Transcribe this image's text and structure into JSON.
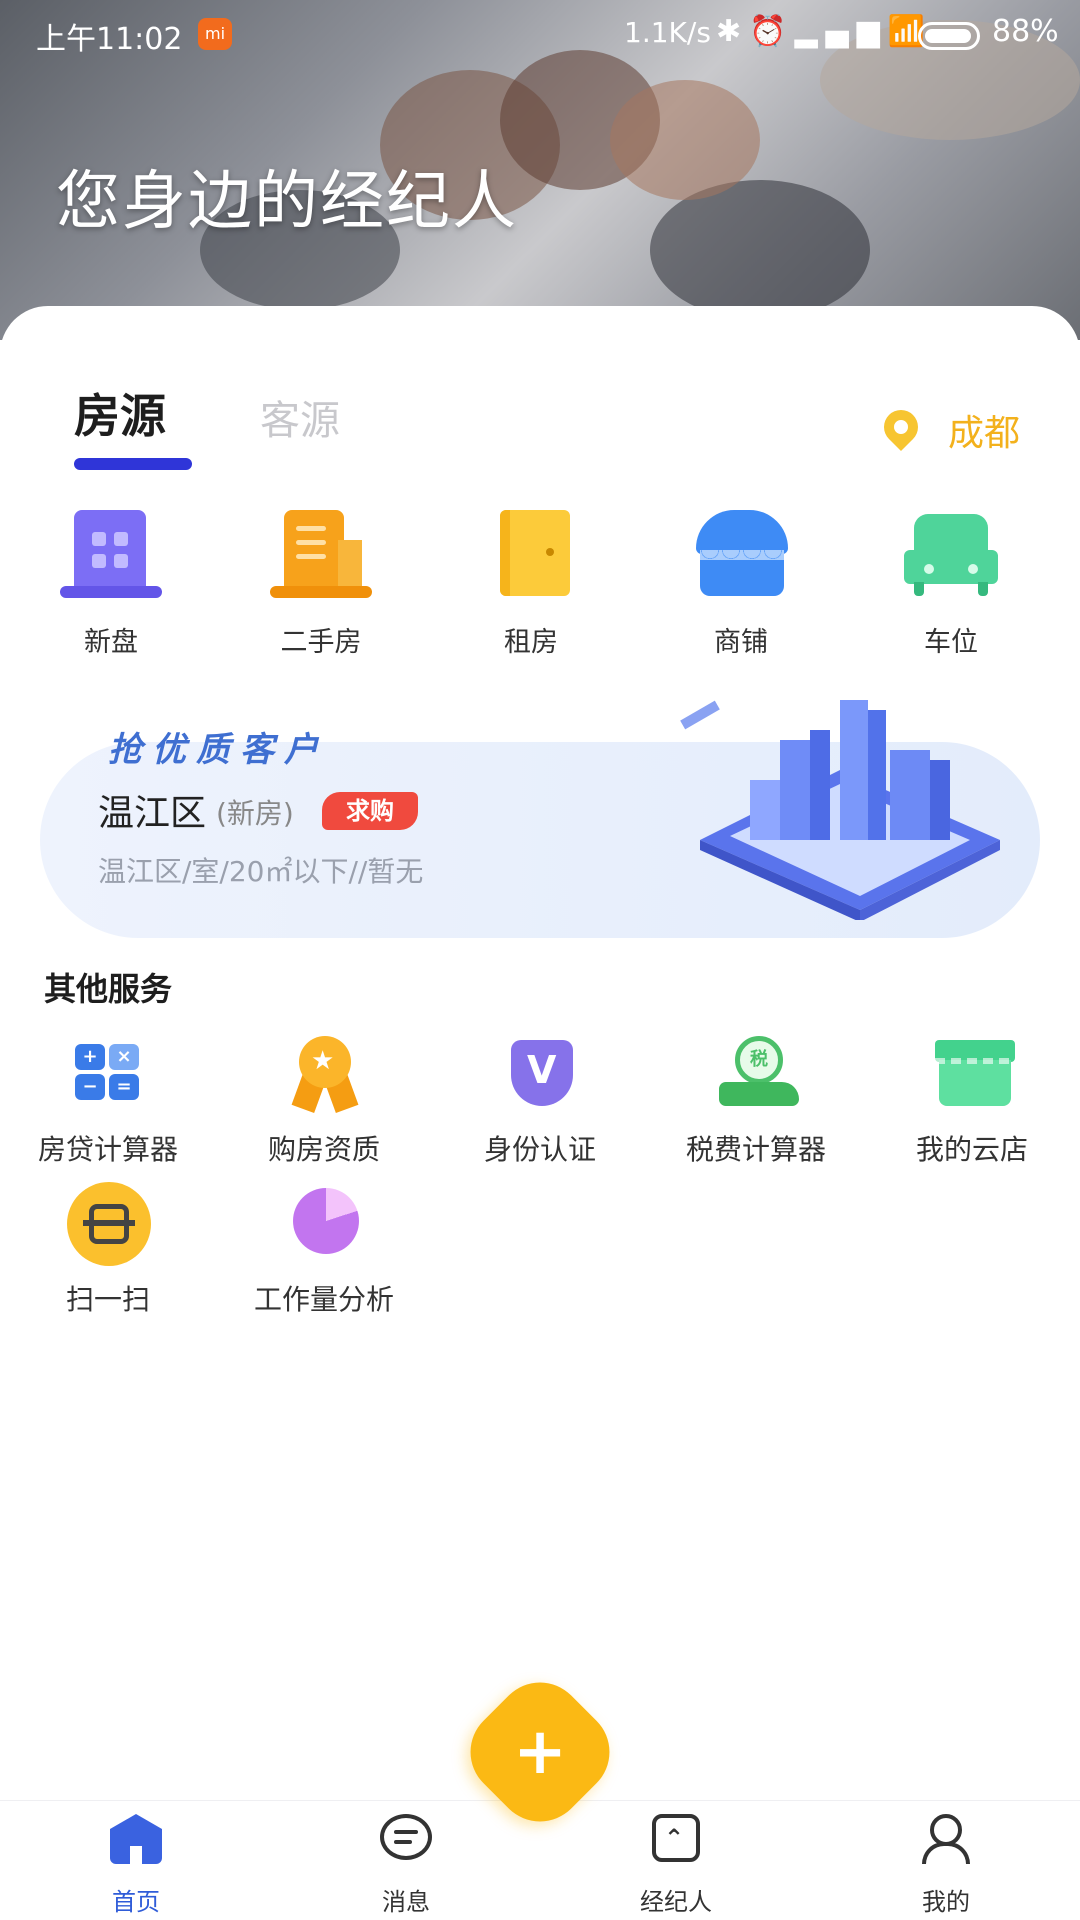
{
  "status_bar": {
    "time": "上午11:02",
    "net_speed": "1.1K/s",
    "battery": "88%",
    "icons": [
      "bluetooth-icon",
      "alarm-icon",
      "signal-icon",
      "wifi-icon",
      "battery-icon"
    ]
  },
  "hero": {
    "title": "您身边的经纪人"
  },
  "tabs": {
    "active": "房源",
    "inactive": "客源"
  },
  "location": {
    "city": "成都",
    "icon": "location-pin-icon"
  },
  "categories": [
    {
      "label": "新盘",
      "icon": "building-icon",
      "color": "#7c6ef5"
    },
    {
      "label": "二手房",
      "icon": "office-building-icon",
      "color": "#f7a21b"
    },
    {
      "label": "租房",
      "icon": "door-icon",
      "color": "#fccb3a"
    },
    {
      "label": "商铺",
      "icon": "shop-icon",
      "color": "#3e8bf5"
    },
    {
      "label": "车位",
      "icon": "car-icon",
      "color": "#4fd49a"
    }
  ],
  "banner": {
    "tag": "抢优质客户",
    "district": "温江区",
    "type": "(新房)",
    "badge": "求购",
    "desc": "温江区/室/20㎡以下//暂无"
  },
  "services": {
    "title": "其他服务",
    "items": [
      {
        "label": "房贷计算器",
        "icon": "calculator-icon"
      },
      {
        "label": "购房资质",
        "icon": "medal-icon"
      },
      {
        "label": "身份认证",
        "icon": "shield-v-icon"
      },
      {
        "label": "税费计算器",
        "icon": "tax-coin-hand-icon"
      },
      {
        "label": "我的云店",
        "icon": "store-icon"
      },
      {
        "label": "扫一扫",
        "icon": "scan-icon"
      },
      {
        "label": "工作量分析",
        "icon": "pie-chart-icon"
      }
    ]
  },
  "bottom_nav": {
    "items": [
      {
        "label": "首页",
        "icon": "home-icon",
        "active": true
      },
      {
        "label": "消息",
        "icon": "message-icon",
        "active": false
      },
      {
        "label": "经纪人",
        "icon": "agent-icon",
        "active": false
      },
      {
        "label": "我的",
        "icon": "profile-icon",
        "active": false
      }
    ],
    "fab": "+"
  },
  "colors": {
    "accent": "#2f35d8",
    "brand_yellow": "#fbb914",
    "city": "#f3b11c",
    "badge_red": "#f04a3e"
  }
}
